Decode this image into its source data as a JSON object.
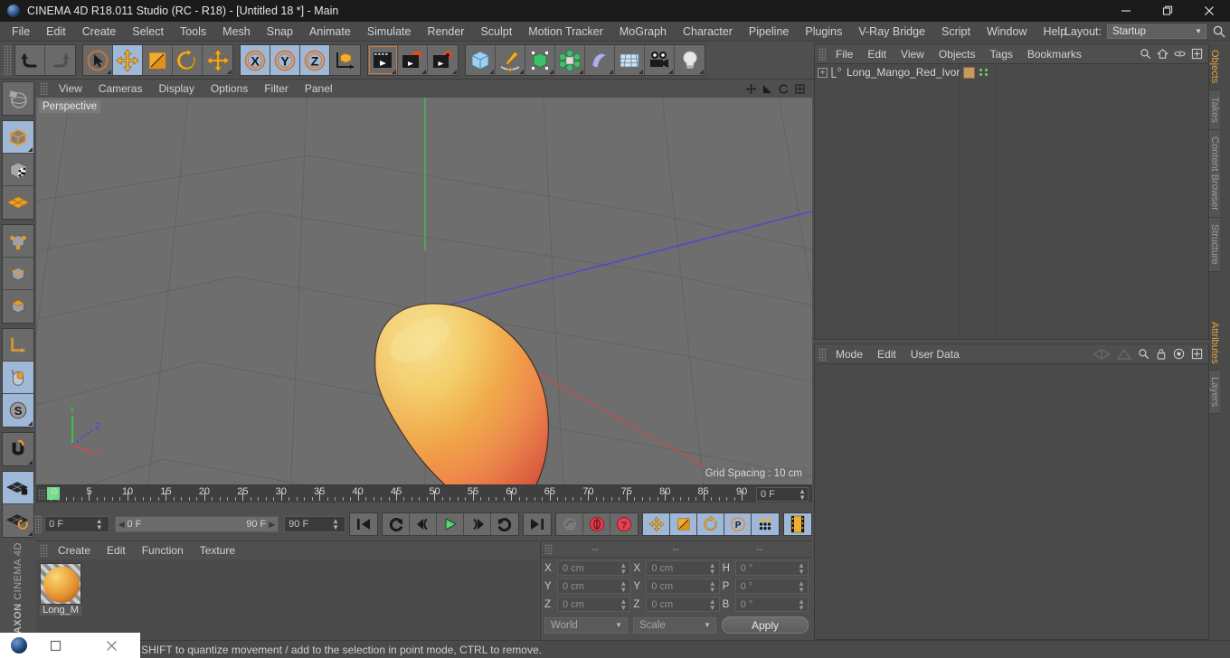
{
  "titlebar": {
    "title": "CINEMA 4D R18.011 Studio (RC - R18) - [Untitled 18 *] - Main",
    "logo_icon": "c4d-logo-icon",
    "minimize": "—",
    "maximize": "❐",
    "close": "✕"
  },
  "menubar": {
    "items": [
      "File",
      "Edit",
      "Create",
      "Select",
      "Tools",
      "Mesh",
      "Snap",
      "Animate",
      "Simulate",
      "Render",
      "Sculpt",
      "Motion Tracker",
      "MoGraph",
      "Character",
      "Pipeline",
      "Plugins",
      "V-Ray Bridge",
      "Script",
      "Window",
      "Help"
    ],
    "layout_label": "Layout:",
    "layout_value": "Startup",
    "search_icon": "search-icon"
  },
  "toolbar": {
    "groups": [
      {
        "name": "undo-redo",
        "buttons": [
          {
            "name": "undo-button",
            "icon": "undo-arrow-icon",
            "active": false
          },
          {
            "name": "redo-button",
            "icon": "redo-arrow-icon",
            "active": false,
            "disabled": true
          }
        ]
      },
      {
        "name": "transform-tools",
        "buttons": [
          {
            "name": "live-selection-tool",
            "icon": "cursor-circle-icon",
            "active": false
          },
          {
            "name": "move-tool",
            "icon": "move-arrows-icon",
            "active": true
          },
          {
            "name": "scale-tool",
            "icon": "scale-box-icon",
            "active": false
          },
          {
            "name": "rotate-tool",
            "icon": "rotate-arc-icon",
            "active": false
          },
          {
            "name": "dynamic-place-tool",
            "icon": "move-arrows-icon",
            "active": false
          }
        ]
      },
      {
        "name": "axis-locks",
        "buttons": [
          {
            "name": "x-axis-lock",
            "icon": "x-axis-icon",
            "active": true
          },
          {
            "name": "y-axis-lock",
            "icon": "y-axis-icon",
            "active": true
          },
          {
            "name": "z-axis-lock",
            "icon": "z-axis-icon",
            "active": true
          },
          {
            "name": "world-object-coordinate-toggle",
            "icon": "coordinate-cube-icon",
            "active": false
          }
        ]
      },
      {
        "name": "render-tools",
        "buttons": [
          {
            "name": "render-view-button",
            "icon": "clapper-icon",
            "active": false,
            "selected": true
          },
          {
            "name": "render-to-picture-viewer-button",
            "icon": "clapper-picture-icon",
            "active": false
          },
          {
            "name": "render-settings-button",
            "icon": "clapper-gear-icon",
            "active": false
          }
        ]
      },
      {
        "name": "create-objects",
        "buttons": [
          {
            "name": "add-cube-object-button",
            "icon": "cube-blue-icon",
            "active": false
          },
          {
            "name": "add-spline-button",
            "icon": "pen-spline-icon",
            "active": false
          },
          {
            "name": "add-nurbs-button",
            "icon": "green-cube-cage-icon",
            "active": false
          },
          {
            "name": "add-array-button",
            "icon": "green-array-icon",
            "active": false
          },
          {
            "name": "add-deformer-button",
            "icon": "bend-deformer-icon",
            "active": false
          },
          {
            "name": "add-scene-environment-button",
            "icon": "floor-grid-icon",
            "active": false
          },
          {
            "name": "add-camera-button",
            "icon": "camera-icon",
            "active": false
          },
          {
            "name": "add-light-button",
            "icon": "lightbulb-icon",
            "active": false
          }
        ]
      }
    ]
  },
  "left_toolbar": {
    "groups": [
      {
        "buttons": [
          {
            "name": "make-editable-tool",
            "icon": "globe-editable-icon",
            "active": false
          }
        ]
      },
      {
        "buttons": [
          {
            "name": "model-mode-tool",
            "icon": "model-cube-icon",
            "active": true
          },
          {
            "name": "texture-mode-tool",
            "icon": "texture-cube-icon",
            "active": false
          },
          {
            "name": "workplane-mode-tool",
            "icon": "workplane-grid-icon",
            "active": false
          }
        ]
      },
      {
        "buttons": [
          {
            "name": "points-mode-tool",
            "icon": "points-cube-icon",
            "active": false
          },
          {
            "name": "edges-mode-tool",
            "icon": "edges-cube-icon",
            "active": false
          },
          {
            "name": "polygons-mode-tool",
            "icon": "polygons-cube-icon",
            "active": false
          }
        ]
      },
      {
        "buttons": [
          {
            "name": "object-axis-tool",
            "icon": "axis-corner-icon",
            "active": false
          },
          {
            "name": "enable-snapping-tool",
            "icon": "mouse-snap-icon",
            "active": true
          },
          {
            "name": "soft-selection-tool",
            "icon": "s-circle-icon",
            "active": true
          }
        ]
      },
      {
        "buttons": [
          {
            "name": "magnet-tool",
            "icon": "magnet-icon",
            "active": false
          }
        ]
      },
      {
        "buttons": [
          {
            "name": "lock-workplane-tool",
            "icon": "grid-lock-icon",
            "active": true
          },
          {
            "name": "planar-workplane-tool",
            "icon": "grid-rotate-icon",
            "active": false
          }
        ]
      }
    ],
    "brand": "MAXON",
    "brand_sub": "CINEMA 4D"
  },
  "viewport": {
    "menu": [
      "View",
      "Cameras",
      "Display",
      "Options",
      "Filter",
      "Panel"
    ],
    "label": "Perspective",
    "grid_spacing": "Grid Spacing : 10 cm",
    "axis_gizmo": {
      "x": "X",
      "y": "Y",
      "z": "Z"
    },
    "icons": [
      "viewport-move-icon",
      "viewport-scale-icon",
      "viewport-rotate-icon",
      "viewport-maximize-icon"
    ],
    "colors": {
      "background": "#6e6e6e",
      "grid_line": "#5f5f5f",
      "axis_x": "#c44d4d",
      "axis_y": "#4fb04f",
      "axis_z": "#4a4ac0",
      "mango_light": "#f0c757",
      "mango_mid": "#f0a245",
      "mango_dark": "#e8533c"
    }
  },
  "timeline": {
    "labels": [
      "0",
      "5",
      "10",
      "15",
      "20",
      "25",
      "30",
      "35",
      "40",
      "45",
      "50",
      "55",
      "60",
      "65",
      "70",
      "75",
      "80",
      "85",
      "90"
    ],
    "values": [
      0,
      5,
      10,
      15,
      20,
      25,
      30,
      35,
      40,
      45,
      50,
      55,
      60,
      65,
      70,
      75,
      80,
      85,
      90
    ],
    "current_frame_field": "0 F"
  },
  "animbar": {
    "current_frame": "0 F",
    "range_start": "0 F",
    "range_end": "90 F",
    "max_frame": "90 F",
    "transport": [
      {
        "name": "go-to-start-button",
        "icon": "skip-start-icon"
      },
      {
        "name": "play-backwards-button",
        "icon": "loop-back-icon"
      },
      {
        "name": "step-back-button",
        "icon": "prev-frame-icon"
      },
      {
        "name": "play-button",
        "icon": "play-triangle-icon"
      },
      {
        "name": "step-forward-button",
        "icon": "next-frame-icon"
      },
      {
        "name": "loop-button",
        "icon": "loop-forward-icon"
      },
      {
        "name": "go-to-end-button",
        "icon": "skip-end-icon"
      }
    ],
    "keyframe_tools": [
      {
        "name": "record-active-objects-button",
        "icon": "key-disabled-icon"
      },
      {
        "name": "autokeying-button",
        "icon": "red-circle-icon"
      },
      {
        "name": "keyframe-selection-button",
        "icon": "red-question-icon"
      }
    ],
    "key_toggles": [
      {
        "name": "position-key-toggle",
        "icon": "move-arrows-icon",
        "active": true
      },
      {
        "name": "scale-key-toggle",
        "icon": "scale-box-icon",
        "active": true
      },
      {
        "name": "rotation-key-toggle",
        "icon": "rotate-arc-icon",
        "active": true
      },
      {
        "name": "param-key-toggle",
        "icon": "p-circle-icon",
        "active": true
      },
      {
        "name": "point-level-animation-toggle",
        "icon": "dots-grid-icon",
        "active": true
      }
    ],
    "timeline_button": {
      "name": "timeline-button",
      "icon": "film-strip-icon",
      "active": true
    }
  },
  "material_manager": {
    "menu": [
      "Create",
      "Edit",
      "Function",
      "Texture"
    ],
    "materials": [
      {
        "name": "Long_M",
        "icon": "material-sphere-icon"
      }
    ]
  },
  "coordinate_manager": {
    "headers": [
      "--",
      "--",
      "--"
    ],
    "rows": [
      {
        "pos_label": "X",
        "pos_value": "0 cm",
        "size_label": "X",
        "size_value": "0 cm",
        "rot_label": "H",
        "rot_value": "0 °"
      },
      {
        "pos_label": "Y",
        "pos_value": "0 cm",
        "size_label": "Y",
        "size_value": "0 cm",
        "rot_label": "P",
        "rot_value": "0 °"
      },
      {
        "pos_label": "Z",
        "pos_value": "0 cm",
        "size_label": "Z",
        "size_value": "0 cm",
        "rot_label": "B",
        "rot_value": "0 °"
      }
    ],
    "system_dropdown": "World",
    "mode_dropdown": "Scale",
    "apply_button": "Apply"
  },
  "object_manager": {
    "menu": [
      "File",
      "Edit",
      "View",
      "Objects",
      "Tags",
      "Bookmarks"
    ],
    "icons": [
      "search-icon",
      "home-icon",
      "eye-icon",
      "maximize-icon"
    ],
    "objects": [
      {
        "name": "Long_Mango_Red_Ivory",
        "expand": "+",
        "type_icon": "polygon-object-icon",
        "tag_icon": "material-tag-icon"
      }
    ]
  },
  "attribute_manager": {
    "menu": [
      "Mode",
      "Edit",
      "User Data"
    ],
    "icons": [
      "back-arrow-icon",
      "forward-arrow-icon",
      "search-icon",
      "lock-icon",
      "target-icon",
      "maximize-icon"
    ]
  },
  "vertical_tabs": {
    "top": [
      {
        "label": "Objects",
        "active": true
      },
      {
        "label": "Takes",
        "active": false
      },
      {
        "label": "Content Browser",
        "active": false
      },
      {
        "label": "Structure",
        "active": false
      }
    ],
    "bottom": [
      {
        "label": "Attributes",
        "active": true
      },
      {
        "label": "Layers",
        "active": false
      }
    ]
  },
  "statusbar": {
    "message": "move elements. Hold down SHIFT to quantize movement / add to the selection in point mode, CTRL to remove."
  },
  "taskbar_overlay": {
    "logo_icon": "c4d-logo-icon",
    "restore_icon": "❐",
    "close_icon": "✕"
  }
}
